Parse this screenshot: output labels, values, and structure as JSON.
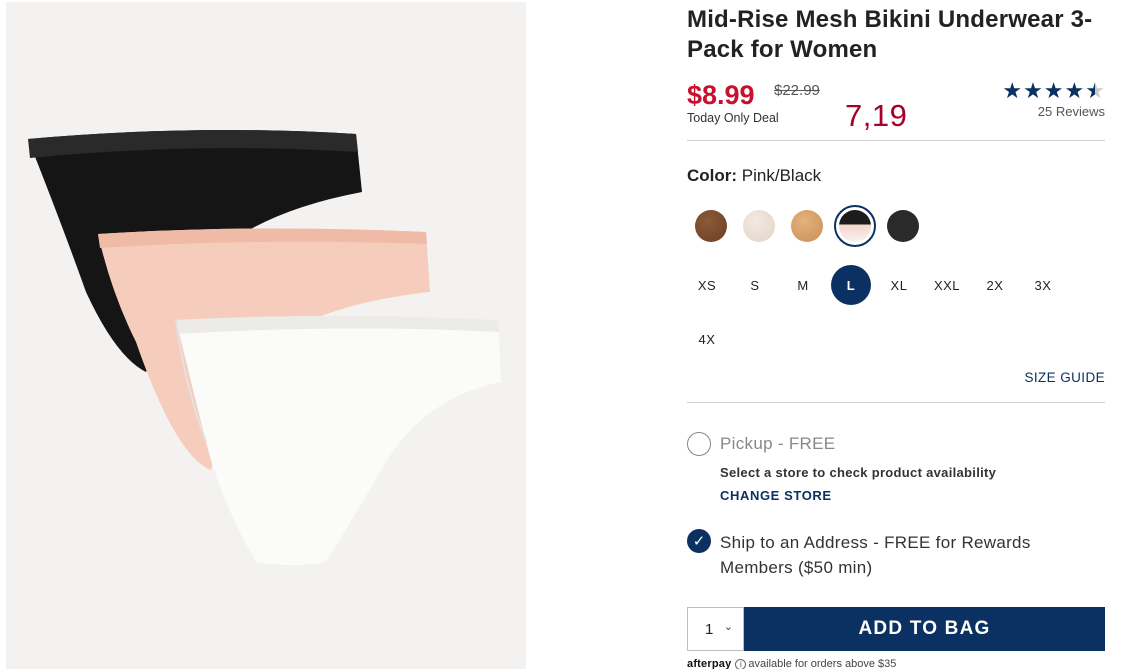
{
  "product": {
    "title": "Mid-Rise Mesh Bikini Underwear 3-Pack for Women",
    "sale_price": "$8.99",
    "original_price": "$22.99",
    "deal_text": "Today Only Deal",
    "overlay_price": "7,19"
  },
  "rating": {
    "value": 4.5,
    "max": 5,
    "reviews_label": "25 Reviews"
  },
  "color": {
    "label": "Color:",
    "selected": "Pink/Black",
    "swatches": [
      {
        "name": "brown",
        "color": "#7a4a2e"
      },
      {
        "name": "ivory",
        "color": "#ebdfd5"
      },
      {
        "name": "tan",
        "color": "#d6a16a"
      },
      {
        "name": "pink-black",
        "color": "#1c1c1c",
        "selected": true
      },
      {
        "name": "black",
        "color": "#2a2a2a"
      }
    ]
  },
  "sizes": {
    "options": [
      "XS",
      "S",
      "M",
      "L",
      "XL",
      "XXL",
      "2X",
      "3X",
      "4X"
    ],
    "selected": "L",
    "guide_label": "SIZE GUIDE"
  },
  "fulfillment": {
    "pickup_label": "Pickup - FREE",
    "pickup_note": "Select a store to check product availability",
    "change_store_label": "CHANGE STORE",
    "ship_label": "Ship to an Address - FREE for Rewards Members ($50 min)"
  },
  "purchase": {
    "quantity": "1",
    "add_to_bag_label": "ADD TO BAG"
  },
  "afterpay": {
    "brand": "afterpay",
    "text": "available for orders above $35"
  },
  "colors": {
    "accent": "#0a3161",
    "sale": "#c8102e"
  }
}
